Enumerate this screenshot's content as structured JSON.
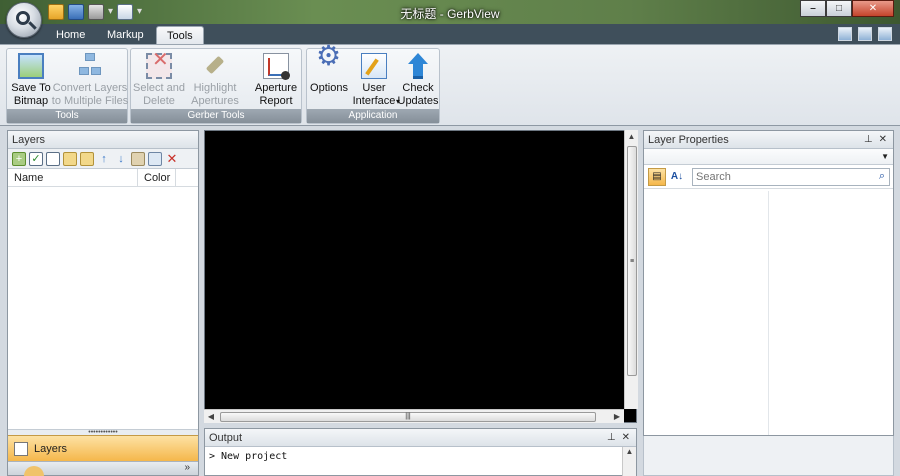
{
  "window": {
    "title": "无标题 - GerbView",
    "controls": {
      "minimize": "–",
      "maximize": "□",
      "close": "✕"
    }
  },
  "quick_access": {
    "icons": [
      "open-icon",
      "save-icon",
      "print-icon",
      "export-icon"
    ],
    "more": "▾"
  },
  "ribbon": {
    "tabs": [
      {
        "label": "Home",
        "active": false
      },
      {
        "label": "Markup",
        "active": false
      },
      {
        "label": "Tools",
        "active": true
      }
    ],
    "groups": [
      {
        "label": "Tools",
        "buttons": [
          {
            "label": "Save To\nBitmap",
            "icon": "bitmap-icon",
            "enabled": true
          },
          {
            "label": "Convert Layers\nto Multiple Files",
            "icon": "layers-convert-icon",
            "enabled": false
          }
        ]
      },
      {
        "label": "Gerber Tools",
        "buttons": [
          {
            "label": "Select and\nDelete",
            "icon": "select-delete-icon",
            "enabled": false
          },
          {
            "label": "Highlight\nApertures",
            "icon": "highlight-icon",
            "enabled": false
          },
          {
            "label": "Aperture\nReport",
            "icon": "report-icon",
            "enabled": true
          }
        ]
      },
      {
        "label": "Application",
        "buttons": [
          {
            "label": "Options",
            "icon": "options-icon",
            "enabled": true
          },
          {
            "label": "User\nInterface",
            "icon": "user-interface-icon",
            "enabled": true,
            "dropdown": "▾"
          },
          {
            "label": "Check\nUpdates",
            "icon": "check-updates-icon",
            "enabled": true
          }
        ]
      }
    ]
  },
  "layers_panel": {
    "title": "Layers",
    "toolbar_icons": [
      "add-layer-icon",
      "check-all-icon",
      "uncheck-all-icon",
      "copy-icon",
      "paste-icon",
      "move-up-icon",
      "move-down-icon",
      "merge-icon",
      "zoom-icon",
      "delete-icon"
    ],
    "columns": [
      "Name",
      "Color"
    ],
    "rows": [],
    "nav_label": "Layers",
    "more_glyph": "»"
  },
  "canvas": {
    "background": "#000000"
  },
  "output_panel": {
    "title": "Output",
    "lines": [
      "> New project"
    ],
    "pin_glyph": "⊥",
    "close_glyph": "✕"
  },
  "properties_panel": {
    "title": "Layer Properties",
    "search_placeholder": "Search",
    "pin_glyph": "⊥",
    "close_glyph": "✕"
  }
}
